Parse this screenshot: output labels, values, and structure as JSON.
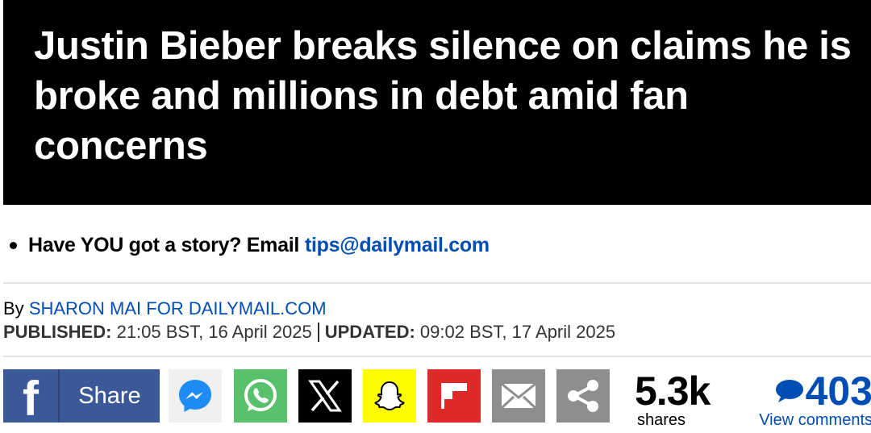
{
  "headline": "Justin Bieber breaks silence on claims he is broke and millions in debt amid fan concerns",
  "tips": {
    "text": "Have YOU got a story? Email",
    "email": "tips@dailymail.com"
  },
  "byline": {
    "prefix": "By",
    "author": "SHARON MAI FOR DAILYMAIL.COM"
  },
  "dates": {
    "published_label": "PUBLISHED:",
    "published_value": "21:05 BST, 16 April 2025",
    "updated_label": "UPDATED:",
    "updated_value": "09:02 BST, 17 April 2025"
  },
  "share": {
    "facebook_label": "Share",
    "buttons": [
      {
        "name": "facebook-icon",
        "color": "#3b5998"
      },
      {
        "name": "messenger-icon",
        "color": "#f0f0f0"
      },
      {
        "name": "whatsapp-icon",
        "color": "#59c06b"
      },
      {
        "name": "x-icon",
        "color": "#000000"
      },
      {
        "name": "snapchat-icon",
        "color": "#fffc00"
      },
      {
        "name": "flipboard-icon",
        "color": "#e12828"
      },
      {
        "name": "email-icon",
        "color": "#8e8e8e"
      },
      {
        "name": "share-icon",
        "color": "#8e8e8e"
      }
    ],
    "shares_count": "5.3k",
    "shares_label": "shares",
    "comments_count": "403",
    "comments_label": "View comments"
  },
  "colors": {
    "link": "#004db3",
    "headline_bg": "#000000"
  }
}
